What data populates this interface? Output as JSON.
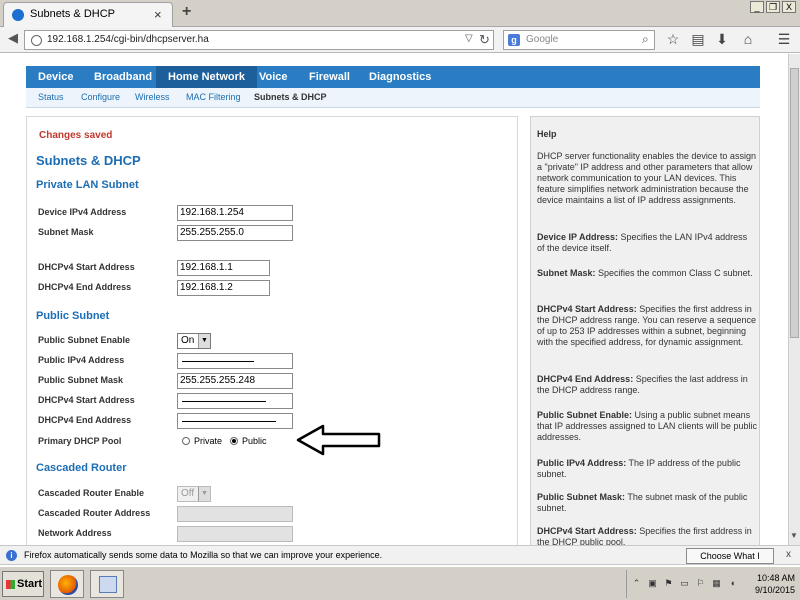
{
  "window": {
    "tab_title": "Subnets & DHCP",
    "tab_close": "×",
    "new_tab": "+",
    "min": "_",
    "restore": "❐",
    "close": "X"
  },
  "navbar": {
    "url": "192.168.1.254/cgi-bin/dhcpserver.ha",
    "search_placeholder": "Google",
    "search_engine": "g"
  },
  "main_tabs": [
    {
      "label": "Device",
      "active": false
    },
    {
      "label": "Broadband",
      "active": false
    },
    {
      "label": "Home Network",
      "active": true
    },
    {
      "label": "Voice",
      "active": false
    },
    {
      "label": "Firewall",
      "active": false
    },
    {
      "label": "Diagnostics",
      "active": false
    }
  ],
  "sub_tabs": [
    {
      "label": "Status",
      "active": false
    },
    {
      "label": "Configure",
      "active": false
    },
    {
      "label": "Wireless",
      "active": false
    },
    {
      "label": "MAC Filtering",
      "active": false
    },
    {
      "label": "Subnets & DHCP",
      "active": true
    }
  ],
  "content": {
    "changes_saved": "Changes saved",
    "page_title": "Subnets & DHCP",
    "private_lan": {
      "title": "Private LAN Subnet",
      "device_ipv4_label": "Device IPv4 Address",
      "device_ipv4_value": "192.168.1.254",
      "subnet_mask_label": "Subnet Mask",
      "subnet_mask_value": "255.255.255.0",
      "dhcp_start_label": "DHCPv4 Start Address",
      "dhcp_start_value": "192.168.1.1",
      "dhcp_end_label": "DHCPv4 End Address",
      "dhcp_end_value": "192.168.1.2"
    },
    "public_subnet": {
      "title": "Public Subnet",
      "enable_label": "Public Subnet Enable",
      "enable_value": "On",
      "public_ipv4_label": "Public IPv4 Address",
      "public_mask_label": "Public Subnet Mask",
      "public_mask_value": "255.255.255.248",
      "dhcp_start_label": "DHCPv4 Start Address",
      "dhcp_end_label": "DHCPv4 End Address",
      "pool_label": "Primary DHCP Pool",
      "pool_private": "Private",
      "pool_public": "Public",
      "pool_selected": "Public"
    },
    "cascaded_router": {
      "title": "Cascaded Router",
      "enable_label": "Cascaded Router Enable",
      "enable_value": "Off",
      "address_label": "Cascaded Router Address",
      "network_label": "Network Address"
    }
  },
  "help": {
    "title": "Help",
    "intro": "DHCP server functionality enables the device to assign a \"private\" IP address and other parameters that allow network communication to your LAN devices. This feature simplifies network administration because the device maintains a list of IP address assignments.",
    "items": [
      {
        "term": "Device IP Address:",
        "text": " Specifies the LAN IPv4 address of the device itself."
      },
      {
        "term": "Subnet Mask:",
        "text": " Specifies the common Class C subnet."
      },
      {
        "term": "DHCPv4 Start Address:",
        "text": " Specifies the first address in the DHCP address range. You can reserve a sequence of up to 253 IP addresses within a subnet, beginning with the specified address, for dynamic assignment."
      },
      {
        "term": "DHCPv4 End Address:",
        "text": " Specifies the last address in the DHCP address range."
      },
      {
        "term": "Public Subnet Enable:",
        "text": " Using a public subnet means that IP addresses assigned to LAN clients will be public addresses."
      },
      {
        "term": "Public IPv4 Address:",
        "text": " The IP address of the public subnet."
      },
      {
        "term": "Public Subnet Mask:",
        "text": " The subnet mask of the public subnet."
      },
      {
        "term": "DHCPv4 Start Address:",
        "text": " Specifies the first address in the DHCP public pool."
      }
    ]
  },
  "notification": {
    "text": "Firefox automatically sends some data to Mozilla so that we can improve your experience.",
    "button": "Choose What I Share",
    "close": "x"
  },
  "taskbar": {
    "start": "Start",
    "time": "10:48 AM",
    "date": "9/10/2015"
  }
}
